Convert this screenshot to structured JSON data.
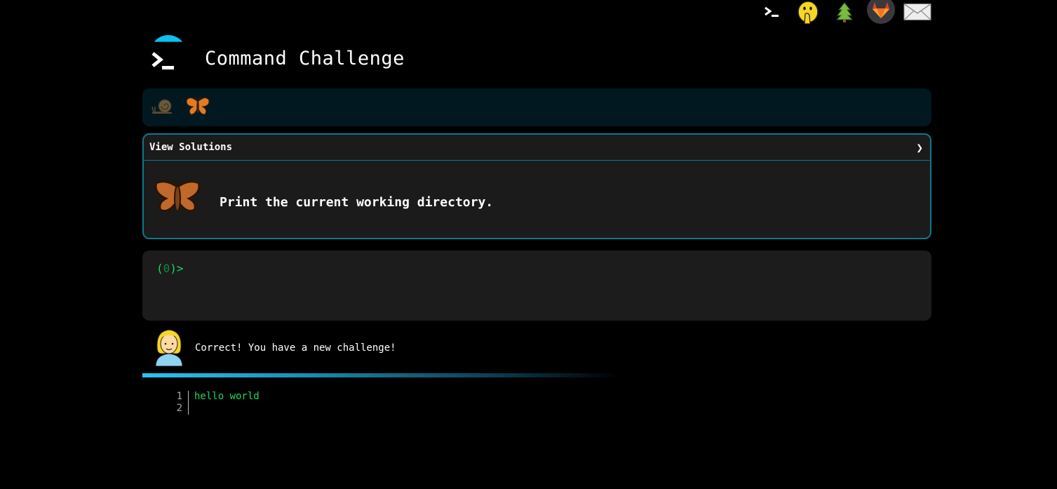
{
  "header": {
    "title": "Command Challenge",
    "icons": [
      {
        "name": "terminal-icon"
      },
      {
        "name": "shush-face-icon"
      },
      {
        "name": "tree-icon"
      },
      {
        "name": "gitlab-icon"
      },
      {
        "name": "mail-icon"
      }
    ]
  },
  "progress": {
    "icons": [
      "snail-icon",
      "butterfly-icon"
    ]
  },
  "challenge": {
    "header_label": "View Solutions",
    "chevron": "❯",
    "task": "Print the current working directory."
  },
  "terminal": {
    "prompt_open": "(",
    "prompt_count": "0",
    "prompt_close": ")>"
  },
  "feedback": {
    "message": "Correct! You have a new challenge!"
  },
  "output": {
    "lines": [
      {
        "num": "1",
        "text": "hello world"
      },
      {
        "num": "2",
        "text": ""
      }
    ]
  },
  "colors": {
    "accent": "#0bc1f2",
    "border": "#0e7791",
    "prompt_green": "#1ed760"
  }
}
